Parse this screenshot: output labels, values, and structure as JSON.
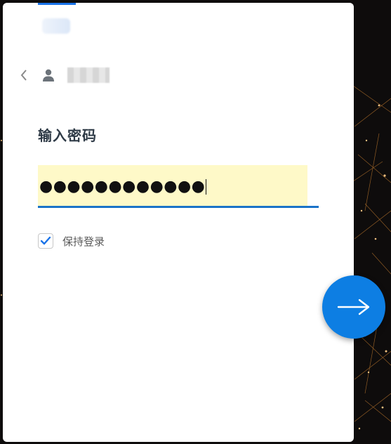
{
  "login": {
    "title": "输入密码",
    "password_masked": "●●●●●●●●●●●●",
    "keep_signed_in_label": "保持登录",
    "keep_signed_in_checked": true
  },
  "icons": {
    "back": "chevron-left-icon",
    "user": "user-icon",
    "check": "check-icon",
    "next": "arrow-right-icon"
  },
  "colors": {
    "accent": "#1a73e8",
    "next_button": "#0d7ee3",
    "field_highlight": "#fef9c8",
    "title_text": "#2f3b47"
  }
}
